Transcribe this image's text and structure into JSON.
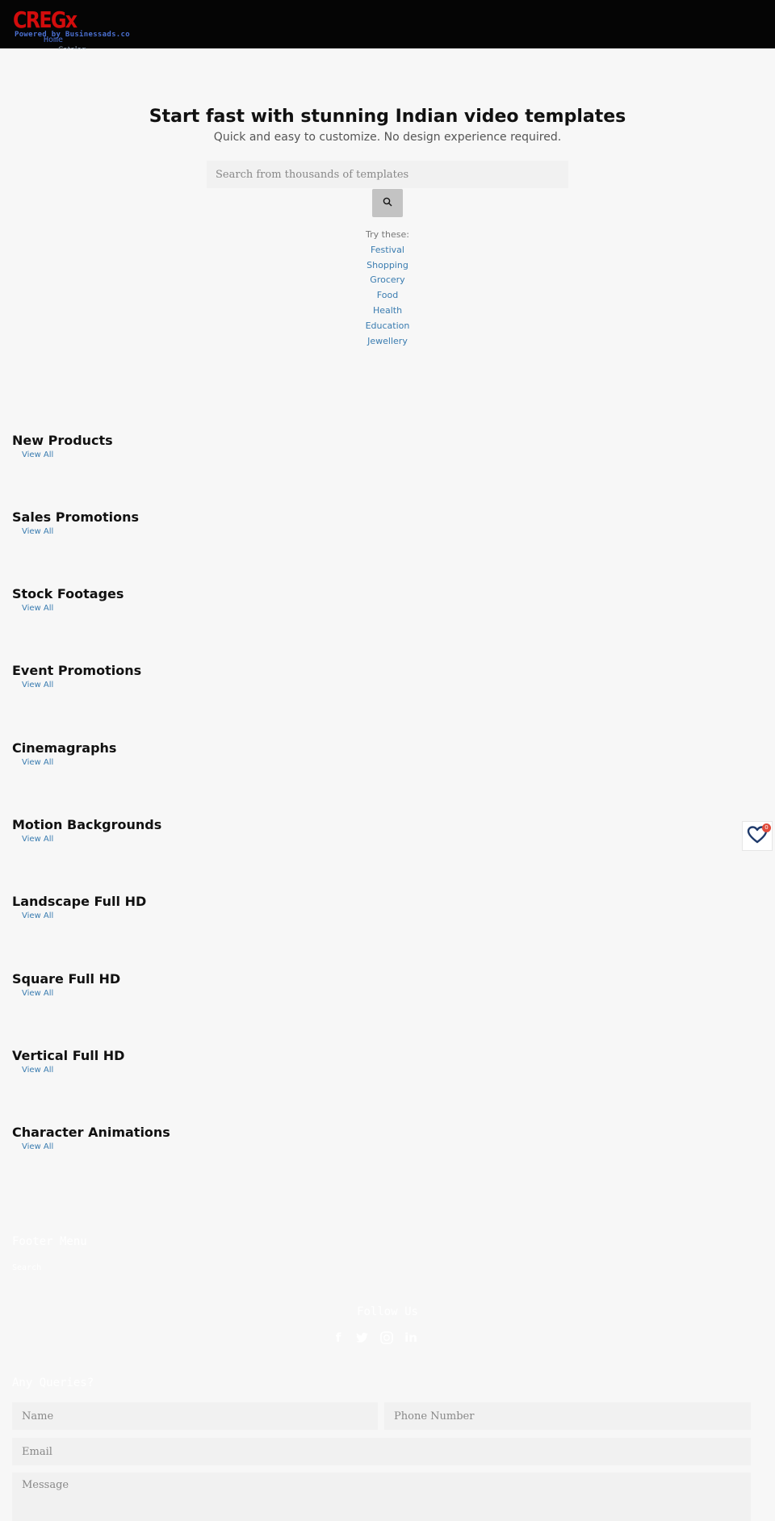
{
  "header": {
    "logo_text": "CREGx",
    "powered_by": "Powered by Businessads.co",
    "nav": [
      "Home",
      "Catalog"
    ]
  },
  "hero": {
    "title": "Start fast with stunning Indian video templates",
    "subtitle": "Quick and easy to customize. No design experience required.",
    "search_placeholder": "Search from thousands of templates",
    "search_icon": "search-icon",
    "try_label": "Try these:",
    "suggestions": [
      "Festival",
      "Shopping",
      "Grocery",
      "Food",
      "Health",
      "Education",
      "Jewellery"
    ]
  },
  "sections": [
    {
      "title": "New Products",
      "link": "View All"
    },
    {
      "title": "Sales Promotions",
      "link": "View All"
    },
    {
      "title": "Stock Footages",
      "link": "View All"
    },
    {
      "title": "Event Promotions",
      "link": "View All"
    },
    {
      "title": "Cinemagraphs",
      "link": "View All"
    },
    {
      "title": "Motion Backgrounds",
      "link": "View All"
    },
    {
      "title": "Landscape Full HD",
      "link": "View All"
    },
    {
      "title": "Square Full HD",
      "link": "View All"
    },
    {
      "title": "Vertical Full HD",
      "link": "View All"
    },
    {
      "title": "Character Animations",
      "link": "View All"
    }
  ],
  "wishlist": {
    "icon": "heart-icon",
    "count": "0",
    "colors": {
      "icon": "#1f3a6b",
      "badge": "#e04a3a"
    }
  },
  "footer": {
    "menu_title": "Footer Menu",
    "menu_items": [
      "Search"
    ],
    "follow_title": "Follow Us",
    "socials": [
      "facebook-icon",
      "twitter-icon",
      "instagram-icon",
      "linkedin-icon"
    ],
    "queries_title": "Any Queries?",
    "form": {
      "name_placeholder": "Name",
      "phone_placeholder": "Phone Number",
      "email_placeholder": "Email",
      "message_placeholder": "Message"
    }
  },
  "colors": {
    "header_bg": "#050505",
    "logo": "#d20c0c",
    "link": "#3a7cb0",
    "page_bg": "#f7f7f7"
  }
}
